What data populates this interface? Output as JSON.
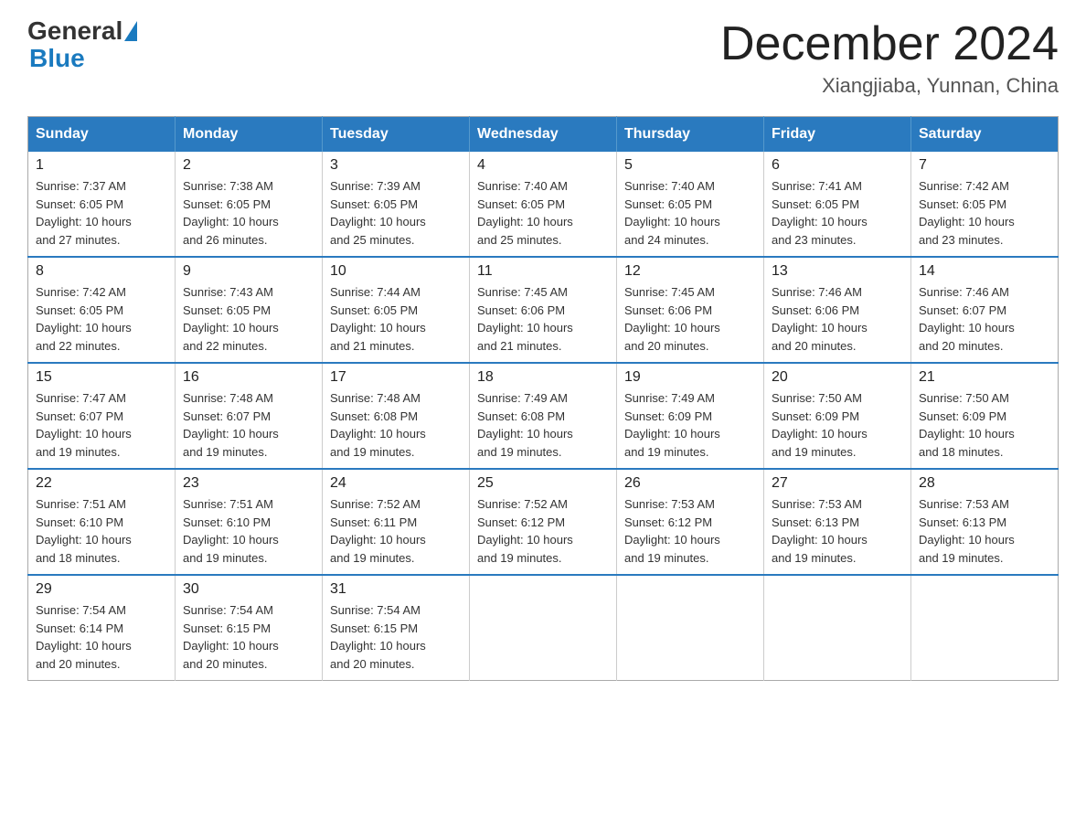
{
  "header": {
    "logo_general": "General",
    "logo_blue": "Blue",
    "main_title": "December 2024",
    "subtitle": "Xiangjiaba, Yunnan, China"
  },
  "calendar": {
    "days_of_week": [
      "Sunday",
      "Monday",
      "Tuesday",
      "Wednesday",
      "Thursday",
      "Friday",
      "Saturday"
    ],
    "weeks": [
      [
        {
          "day": "1",
          "sunrise": "7:37 AM",
          "sunset": "6:05 PM",
          "daylight": "10 hours and 27 minutes."
        },
        {
          "day": "2",
          "sunrise": "7:38 AM",
          "sunset": "6:05 PM",
          "daylight": "10 hours and 26 minutes."
        },
        {
          "day": "3",
          "sunrise": "7:39 AM",
          "sunset": "6:05 PM",
          "daylight": "10 hours and 25 minutes."
        },
        {
          "day": "4",
          "sunrise": "7:40 AM",
          "sunset": "6:05 PM",
          "daylight": "10 hours and 25 minutes."
        },
        {
          "day": "5",
          "sunrise": "7:40 AM",
          "sunset": "6:05 PM",
          "daylight": "10 hours and 24 minutes."
        },
        {
          "day": "6",
          "sunrise": "7:41 AM",
          "sunset": "6:05 PM",
          "daylight": "10 hours and 23 minutes."
        },
        {
          "day": "7",
          "sunrise": "7:42 AM",
          "sunset": "6:05 PM",
          "daylight": "10 hours and 23 minutes."
        }
      ],
      [
        {
          "day": "8",
          "sunrise": "7:42 AM",
          "sunset": "6:05 PM",
          "daylight": "10 hours and 22 minutes."
        },
        {
          "day": "9",
          "sunrise": "7:43 AM",
          "sunset": "6:05 PM",
          "daylight": "10 hours and 22 minutes."
        },
        {
          "day": "10",
          "sunrise": "7:44 AM",
          "sunset": "6:05 PM",
          "daylight": "10 hours and 21 minutes."
        },
        {
          "day": "11",
          "sunrise": "7:45 AM",
          "sunset": "6:06 PM",
          "daylight": "10 hours and 21 minutes."
        },
        {
          "day": "12",
          "sunrise": "7:45 AM",
          "sunset": "6:06 PM",
          "daylight": "10 hours and 20 minutes."
        },
        {
          "day": "13",
          "sunrise": "7:46 AM",
          "sunset": "6:06 PM",
          "daylight": "10 hours and 20 minutes."
        },
        {
          "day": "14",
          "sunrise": "7:46 AM",
          "sunset": "6:07 PM",
          "daylight": "10 hours and 20 minutes."
        }
      ],
      [
        {
          "day": "15",
          "sunrise": "7:47 AM",
          "sunset": "6:07 PM",
          "daylight": "10 hours and 19 minutes."
        },
        {
          "day": "16",
          "sunrise": "7:48 AM",
          "sunset": "6:07 PM",
          "daylight": "10 hours and 19 minutes."
        },
        {
          "day": "17",
          "sunrise": "7:48 AM",
          "sunset": "6:08 PM",
          "daylight": "10 hours and 19 minutes."
        },
        {
          "day": "18",
          "sunrise": "7:49 AM",
          "sunset": "6:08 PM",
          "daylight": "10 hours and 19 minutes."
        },
        {
          "day": "19",
          "sunrise": "7:49 AM",
          "sunset": "6:09 PM",
          "daylight": "10 hours and 19 minutes."
        },
        {
          "day": "20",
          "sunrise": "7:50 AM",
          "sunset": "6:09 PM",
          "daylight": "10 hours and 19 minutes."
        },
        {
          "day": "21",
          "sunrise": "7:50 AM",
          "sunset": "6:09 PM",
          "daylight": "10 hours and 18 minutes."
        }
      ],
      [
        {
          "day": "22",
          "sunrise": "7:51 AM",
          "sunset": "6:10 PM",
          "daylight": "10 hours and 18 minutes."
        },
        {
          "day": "23",
          "sunrise": "7:51 AM",
          "sunset": "6:10 PM",
          "daylight": "10 hours and 19 minutes."
        },
        {
          "day": "24",
          "sunrise": "7:52 AM",
          "sunset": "6:11 PM",
          "daylight": "10 hours and 19 minutes."
        },
        {
          "day": "25",
          "sunrise": "7:52 AM",
          "sunset": "6:12 PM",
          "daylight": "10 hours and 19 minutes."
        },
        {
          "day": "26",
          "sunrise": "7:53 AM",
          "sunset": "6:12 PM",
          "daylight": "10 hours and 19 minutes."
        },
        {
          "day": "27",
          "sunrise": "7:53 AM",
          "sunset": "6:13 PM",
          "daylight": "10 hours and 19 minutes."
        },
        {
          "day": "28",
          "sunrise": "7:53 AM",
          "sunset": "6:13 PM",
          "daylight": "10 hours and 19 minutes."
        }
      ],
      [
        {
          "day": "29",
          "sunrise": "7:54 AM",
          "sunset": "6:14 PM",
          "daylight": "10 hours and 20 minutes."
        },
        {
          "day": "30",
          "sunrise": "7:54 AM",
          "sunset": "6:15 PM",
          "daylight": "10 hours and 20 minutes."
        },
        {
          "day": "31",
          "sunrise": "7:54 AM",
          "sunset": "6:15 PM",
          "daylight": "10 hours and 20 minutes."
        },
        null,
        null,
        null,
        null
      ]
    ],
    "labels": {
      "sunrise": "Sunrise:",
      "sunset": "Sunset:",
      "daylight": "Daylight:"
    }
  }
}
